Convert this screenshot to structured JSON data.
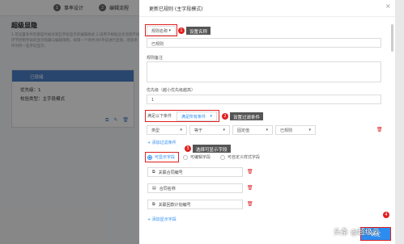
{
  "background": {
    "steps": [
      {
        "num": "1",
        "label": "事率设计"
      },
      {
        "num": "2",
        "label": "编辑流程"
      }
    ],
    "title": "超级显隐",
    "description": "1.可设置条件在哪些时候对某些字段显示的编辑样式 2.适用于根据业务流程不同环节控制字段的显示隐藏与编辑限制，如第一个条件对A字段进行显隐，后续条件对另一些字段显示。",
    "card": {
      "head": "已就绪",
      "priority": "优先级：1",
      "check": "校验类型：主字段模式"
    }
  },
  "drawer": {
    "title": "更新已规则 (主字段模式)",
    "close": "×",
    "rule_name_select": "规则名称",
    "rule_name_value": "已规则",
    "rule_note_label": "规则备注",
    "priority_label": "优先级（越小优先级越高）",
    "priority_value": "1",
    "condition_label": "满足以下条件",
    "condition_select": "满足所有条件",
    "filter_row": {
      "type": "类型",
      "op": "等于",
      "kind": "固定值",
      "value": "已规则"
    },
    "add_filter": "+ 添加过滤条件",
    "field_options": [
      "可显示字段",
      "可编辑字段",
      "可自定义样式字段"
    ],
    "fields": [
      "关联合同编号",
      "合同名称",
      "关联回款计划编号"
    ],
    "add_field": "+ 添加显示字段",
    "ok": "确定"
  },
  "callouts": {
    "c1": {
      "num": "1",
      "text": "设置名称"
    },
    "c2": {
      "num": "2",
      "text": "设置过滤条件"
    },
    "c3": {
      "num": "3",
      "text": "选择可显示字段"
    },
    "c4": {
      "num": "4"
    }
  },
  "watermark": "头条 @超级云"
}
